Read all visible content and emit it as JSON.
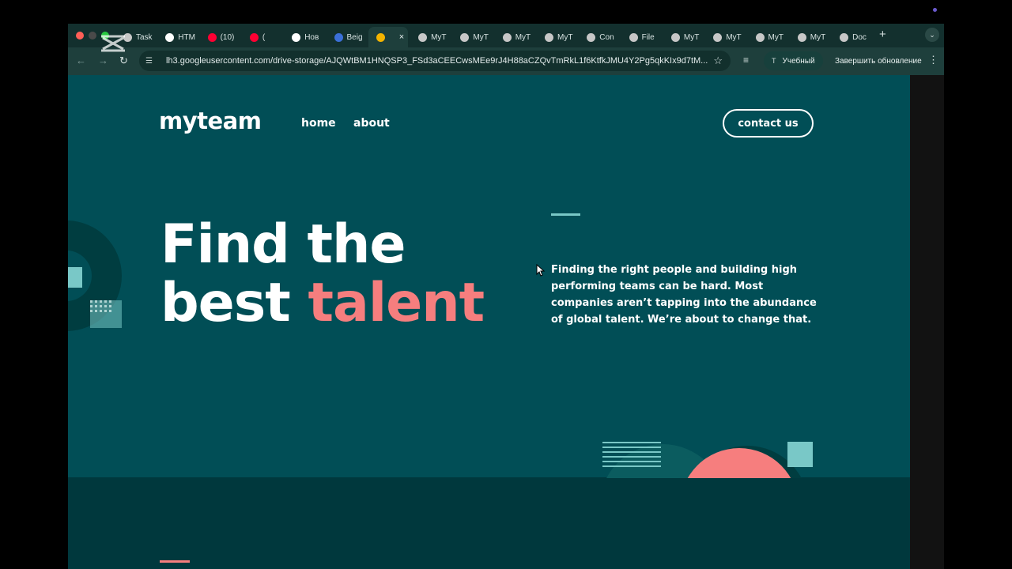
{
  "browser": {
    "tabs": [
      {
        "label": "Task",
        "color": "#c7c7c7"
      },
      {
        "label": "HTM",
        "color": "#ffffff"
      },
      {
        "label": "(10)",
        "color": "#ff0033"
      },
      {
        "label": "(",
        "color": "#ff0033"
      },
      {
        "label": "Hoв",
        "color": "#ffffff"
      },
      {
        "label": "Beig",
        "color": "#3b6fd8"
      },
      {
        "label": "",
        "color": "#f4b400"
      },
      {
        "label": "MyT",
        "color": "#c7c7c7"
      },
      {
        "label": "MyT",
        "color": "#c7c7c7"
      },
      {
        "label": "MyT",
        "color": "#c7c7c7"
      },
      {
        "label": "MyT",
        "color": "#c7c7c7"
      },
      {
        "label": "Con",
        "color": "#c7c7c7"
      },
      {
        "label": "File",
        "color": "#c7c7c7"
      },
      {
        "label": "MyT",
        "color": "#c7c7c7"
      },
      {
        "label": "MyT",
        "color": "#c7c7c7"
      },
      {
        "label": "MyT",
        "color": "#c7c7c7"
      },
      {
        "label": "MyT",
        "color": "#c7c7c7"
      },
      {
        "label": "Doc",
        "color": "#c7c7c7"
      }
    ],
    "active_tab_index": 6,
    "new_tab": "+",
    "url": "lh3.googleusercontent.com/drive-storage/AJQWtBM1HNQSP3_FSd3aCEECwsMEe9rJ4H88aCZQvTmRkL1f6KtfkJMU4Y2Pg5qkKIx9d7tM...",
    "profile_initial": "T",
    "profile_label": "Учебный",
    "update_label": "Завершить обновление"
  },
  "site": {
    "logo": "myteam",
    "nav": [
      {
        "label": "home"
      },
      {
        "label": "about"
      }
    ],
    "contact_button": "contact us",
    "hero": {
      "title_line1": "Find the",
      "title_line2_start": "best ",
      "title_line2_accent": "talent",
      "paragraph": "Finding the right people and building high performing teams can be hard. Most companies aren’t tapping into the abundance of global talent. We’re about to change that."
    },
    "colors": {
      "bg": "#014e56",
      "accent": "#f67e7e",
      "rapture_blue": "#79c8c7",
      "dark_band": "#00383d"
    }
  }
}
